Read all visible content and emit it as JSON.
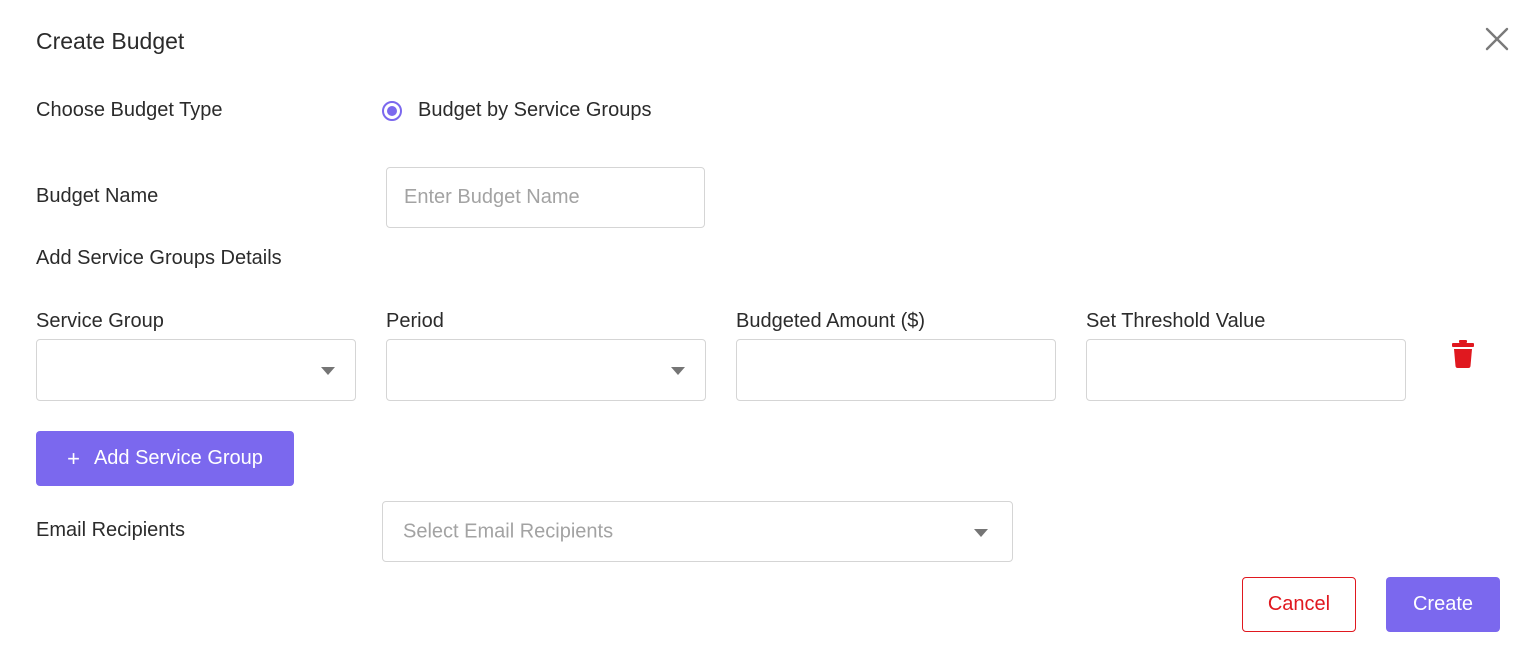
{
  "dialog": {
    "title": "Create Budget"
  },
  "budget_type": {
    "label": "Choose Budget Type",
    "option_label": "Budget by Service Groups",
    "selected": true
  },
  "budget_name": {
    "label": "Budget Name",
    "placeholder": "Enter Budget Name",
    "value": ""
  },
  "service_groups": {
    "section_label": "Add Service Groups Details",
    "columns": {
      "service_group": "Service Group",
      "period": "Period",
      "budgeted_amount": "Budgeted Amount ($)",
      "threshold": "Set Threshold Value"
    },
    "row": {
      "service_group": "",
      "period": "",
      "budgeted_amount": "",
      "threshold": ""
    },
    "add_button_label": "Add Service Group"
  },
  "email_recipients": {
    "label": "Email Recipients",
    "placeholder": "Select Email Recipients"
  },
  "actions": {
    "cancel_label": "Cancel",
    "create_label": "Create"
  },
  "colors": {
    "accent": "#7b68ee",
    "danger": "#e0181f",
    "placeholder": "#a3a3a3",
    "border": "#d5d5d5"
  },
  "icons": {
    "close": "close-icon",
    "caret": "caret-down-icon",
    "delete": "trash-icon",
    "add": "plus-icon"
  }
}
